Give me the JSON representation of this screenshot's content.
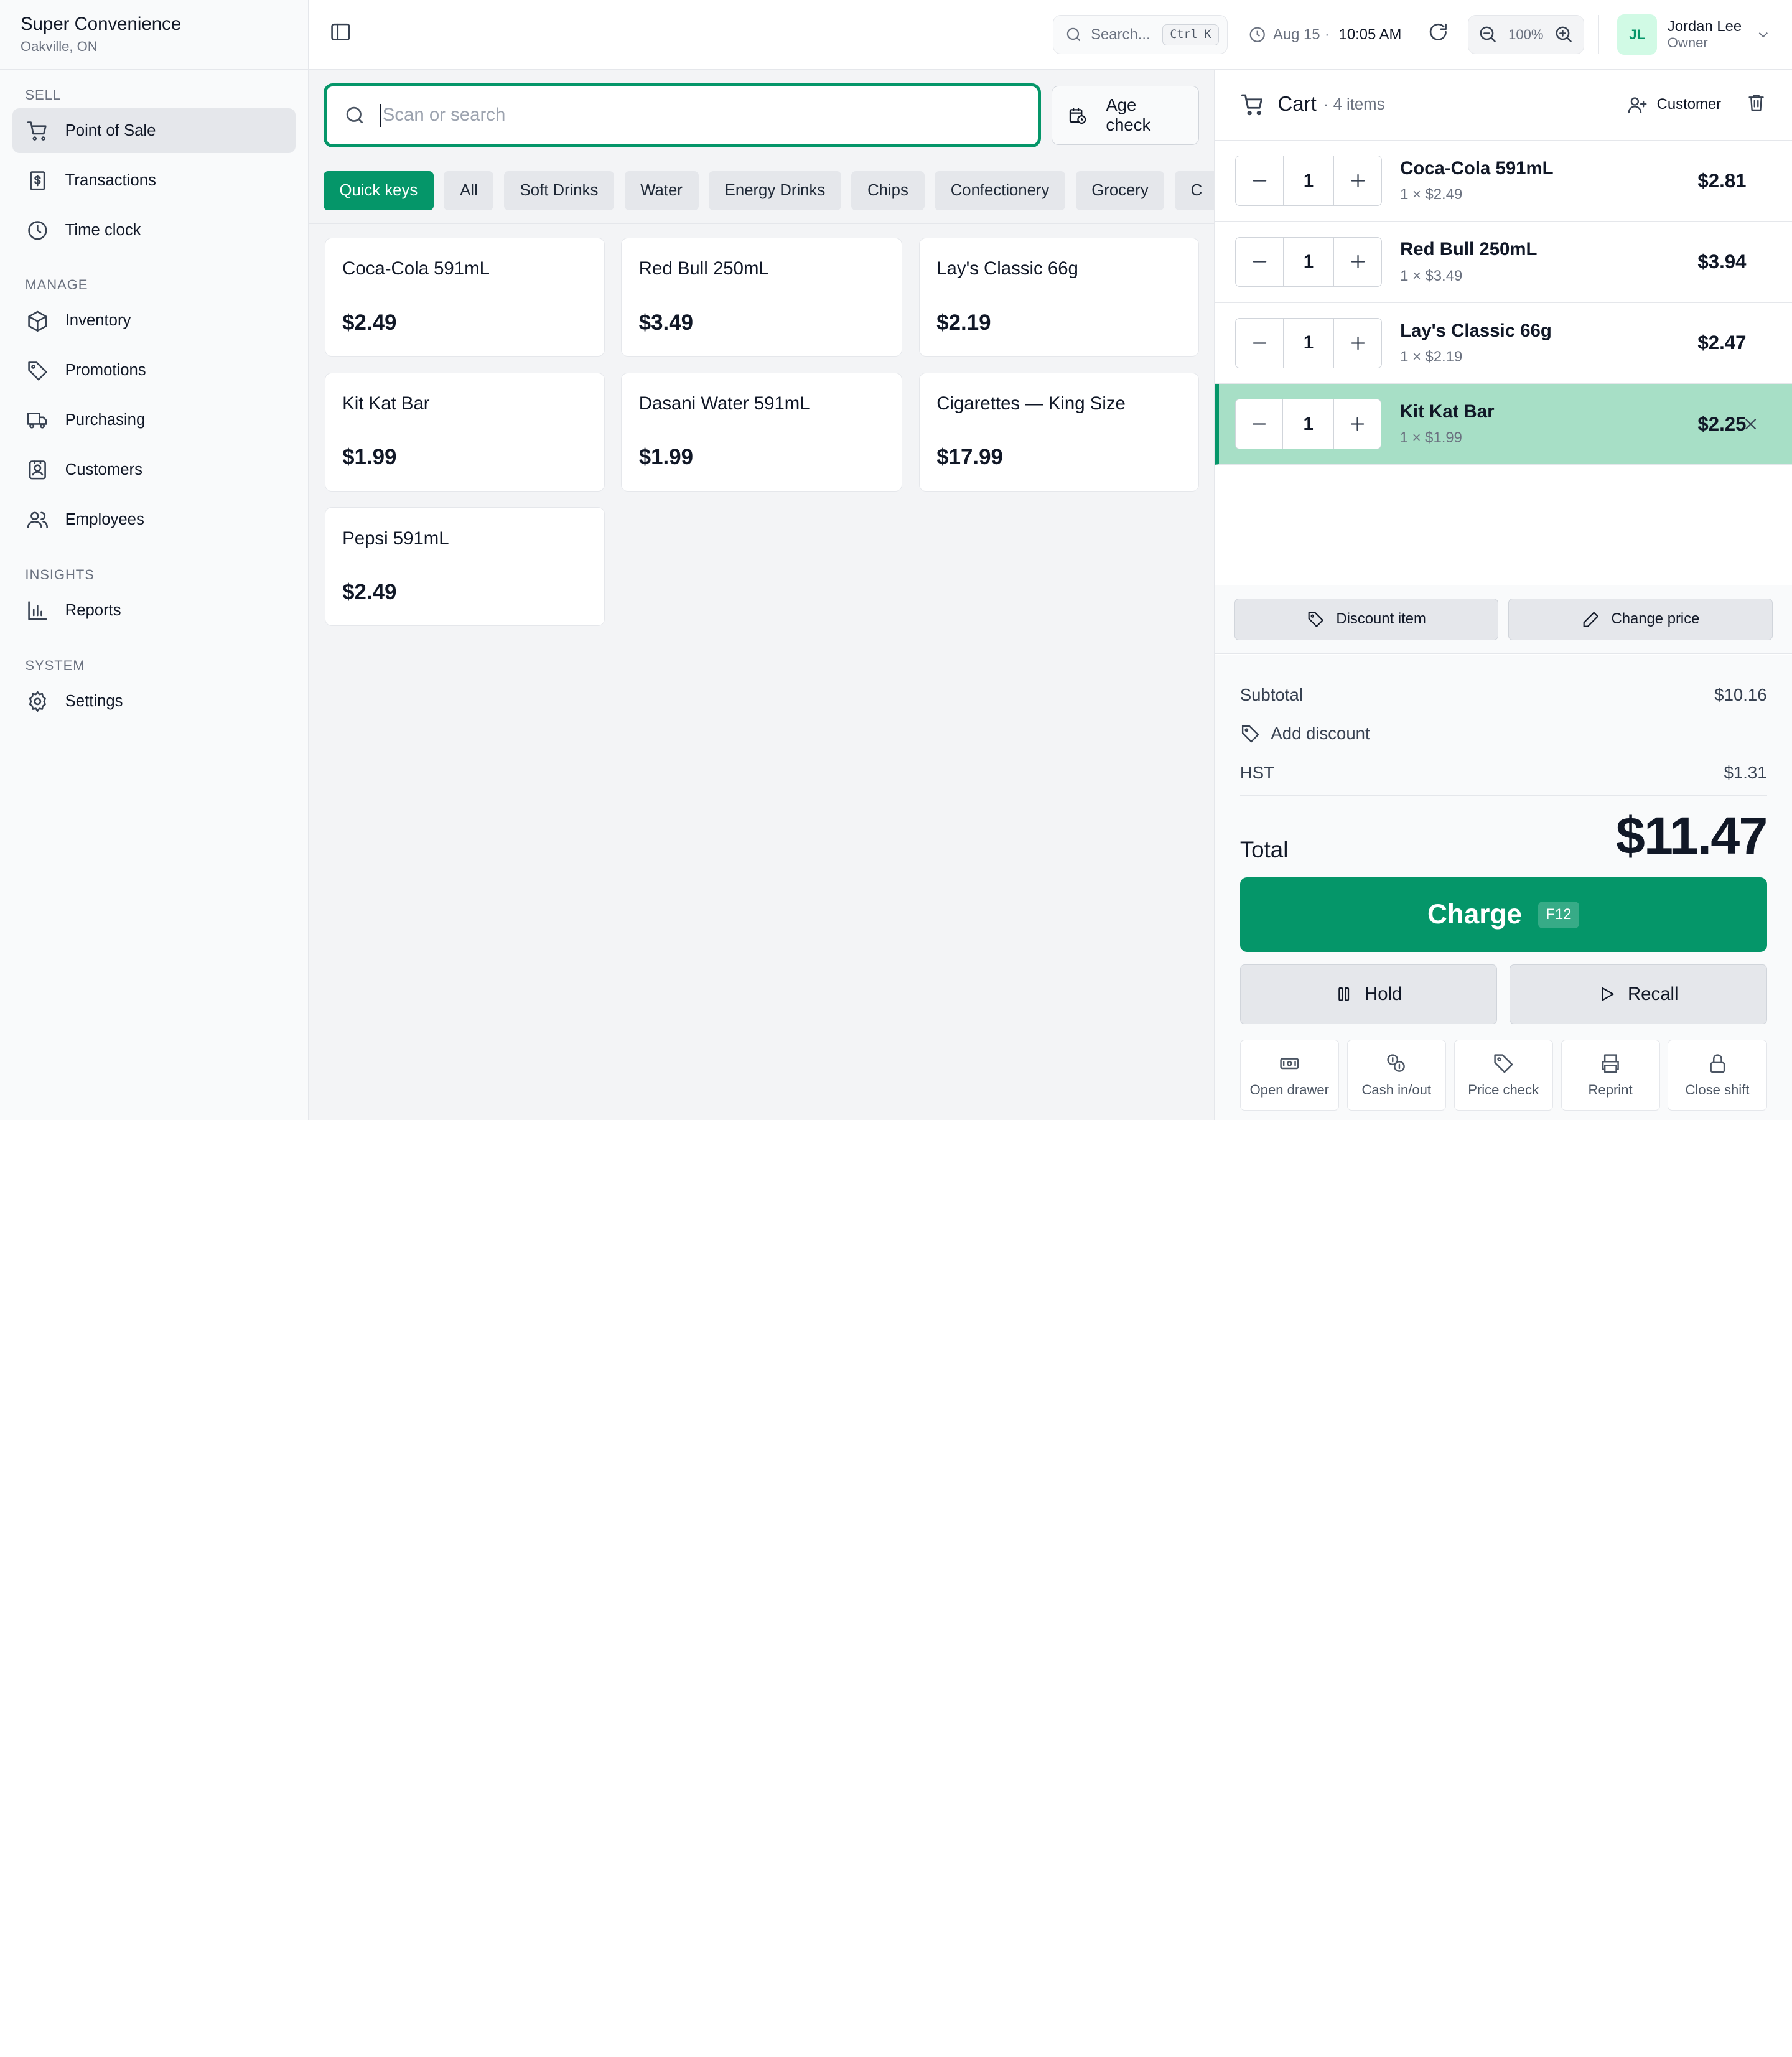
{
  "store": {
    "name": "Super Convenience",
    "location": "Oakville, ON"
  },
  "sidebar": {
    "sections": [
      {
        "title": "SELL",
        "items": [
          {
            "label": "Point of Sale",
            "icon": "cart-icon",
            "active": true
          },
          {
            "label": "Transactions",
            "icon": "receipt-icon"
          },
          {
            "label": "Time clock",
            "icon": "clock-icon"
          }
        ]
      },
      {
        "title": "MANAGE",
        "items": [
          {
            "label": "Inventory",
            "icon": "box-icon"
          },
          {
            "label": "Promotions",
            "icon": "tag-icon"
          },
          {
            "label": "Purchasing",
            "icon": "truck-icon"
          },
          {
            "label": "Customers",
            "icon": "contact-icon"
          },
          {
            "label": "Employees",
            "icon": "users-icon"
          }
        ]
      },
      {
        "title": "INSIGHTS",
        "items": [
          {
            "label": "Reports",
            "icon": "bar-chart-icon"
          }
        ]
      },
      {
        "title": "SYSTEM",
        "items": [
          {
            "label": "Settings",
            "icon": "gear-icon"
          }
        ]
      }
    ]
  },
  "topbar": {
    "search_placeholder": "Search...",
    "search_shortcut": "Ctrl K",
    "date": "Aug 15",
    "time": "10:05 AM",
    "zoom": "100%",
    "user": {
      "initials": "JL",
      "name": "Jordan Lee",
      "role": "Owner"
    }
  },
  "scan": {
    "placeholder": "Scan or search",
    "age_check_label": "Age check"
  },
  "categories": [
    "Quick keys",
    "All",
    "Soft Drinks",
    "Water",
    "Energy Drinks",
    "Chips",
    "Confectionery",
    "Grocery",
    "C"
  ],
  "active_category": "Quick keys",
  "products": [
    {
      "name": "Coca-Cola 591mL",
      "price": "$2.49"
    },
    {
      "name": "Red Bull 250mL",
      "price": "$3.49"
    },
    {
      "name": "Lay's Classic 66g",
      "price": "$2.19"
    },
    {
      "name": "Kit Kat Bar",
      "price": "$1.99"
    },
    {
      "name": "Dasani Water 591mL",
      "price": "$1.99"
    },
    {
      "name": "Cigarettes — King Size",
      "price": "$17.99"
    },
    {
      "name": "Pepsi 591mL",
      "price": "$2.49"
    }
  ],
  "cart": {
    "title": "Cart",
    "count": "· 4 items",
    "customer_label": "Customer",
    "lines": [
      {
        "name": "Coca-Cola 591mL",
        "qty": "1",
        "unit": "1 × $2.49",
        "total": "$2.81",
        "selected": false
      },
      {
        "name": "Red Bull 250mL",
        "qty": "1",
        "unit": "1 × $3.49",
        "total": "$3.94",
        "selected": false
      },
      {
        "name": "Lay's Classic 66g",
        "qty": "1",
        "unit": "1 × $2.19",
        "total": "$2.47",
        "selected": false
      },
      {
        "name": "Kit Kat Bar",
        "qty": "1",
        "unit": "1 × $1.99",
        "total": "$2.25",
        "selected": true
      }
    ],
    "discount_item_label": "Discount item",
    "change_price_label": "Change price",
    "subtotal_label": "Subtotal",
    "subtotal": "$10.16",
    "add_discount_label": "Add discount",
    "tax_label": "HST",
    "tax": "$1.31",
    "total_label": "Total",
    "total": "$11.47",
    "charge_label": "Charge",
    "charge_shortcut": "F12",
    "hold_label": "Hold",
    "recall_label": "Recall",
    "functions": [
      {
        "label": "Open drawer",
        "icon": "cash-drawer-icon"
      },
      {
        "label": "Cash in/out",
        "icon": "coins-icon"
      },
      {
        "label": "Price check",
        "icon": "tag-icon"
      },
      {
        "label": "Reprint",
        "icon": "printer-icon"
      },
      {
        "label": "Close shift",
        "icon": "lock-icon"
      }
    ]
  },
  "colors": {
    "accent": "#059669",
    "selected_row": "#a7dfc6"
  }
}
